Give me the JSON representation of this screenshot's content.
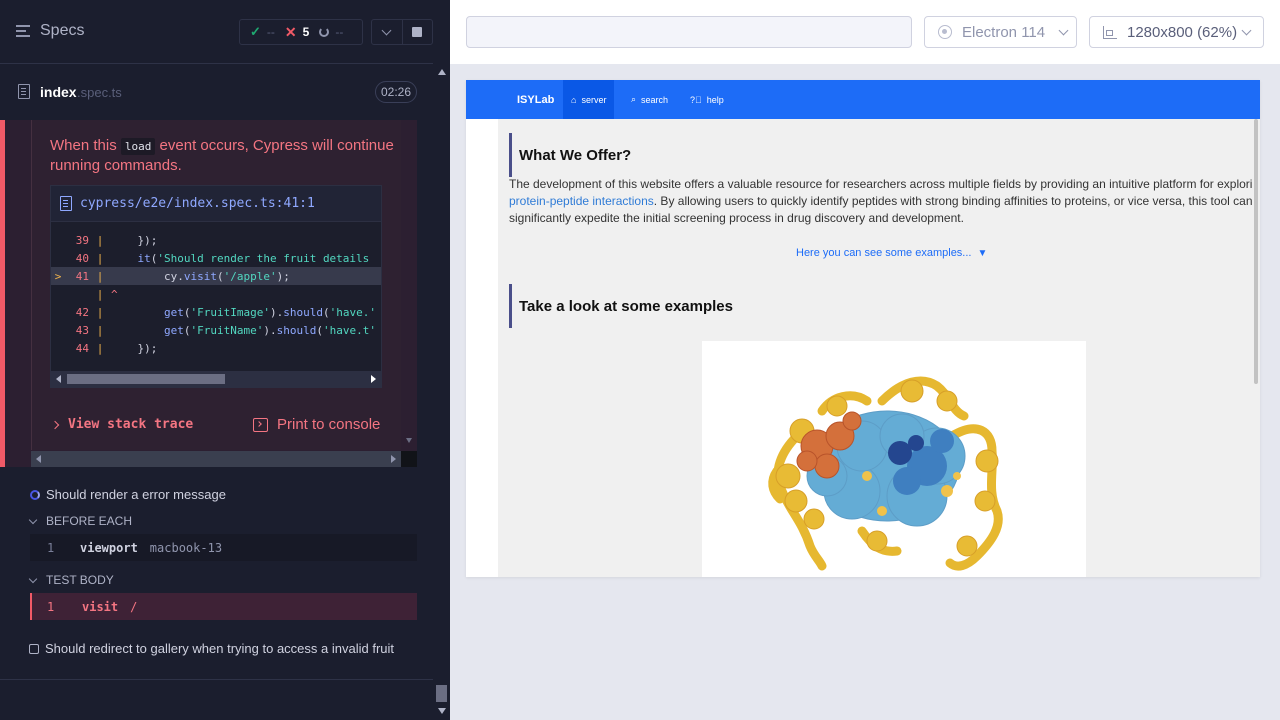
{
  "reporter": {
    "specs_label": "Specs",
    "stats": {
      "passed": "--",
      "failed": "5",
      "pending": "--"
    },
    "spec_file": {
      "name": "index",
      "ext": ".spec.ts",
      "duration": "02:26"
    },
    "error": {
      "message_before": "When this ",
      "message_code": "load",
      "message_after": " event occurs, Cypress will continue running commands.",
      "code_frame_path": "cypress/e2e/index.spec.ts:41:1",
      "code_lines": [
        {
          "num": "39",
          "text": "    });"
        },
        {
          "num": "40",
          "text": "    it('Should render the fruit details"
        },
        {
          "num": "41",
          "text": "        cy.visit('/apple');"
        },
        {
          "num": "",
          "text": "^"
        },
        {
          "num": "42",
          "text": "        get('FruitImage').should('have.'"
        },
        {
          "num": "43",
          "text": "        get('FruitName').should('have.t'"
        },
        {
          "num": "44",
          "text": "    });"
        }
      ],
      "highlight_marker": ">",
      "view_stack_trace": "View stack trace",
      "print_to_console": "Print to console"
    },
    "running_test": "Should render a error message",
    "before_each_label": "BEFORE EACH",
    "before_each_cmd": {
      "num": "1",
      "name": "viewport",
      "arg": "macbook-13"
    },
    "test_body_label": "TEST BODY",
    "test_body_cmd": {
      "num": "1",
      "name": "visit",
      "arg": "/"
    },
    "pending_test": "Should redirect to gallery when trying to access a invalid fruit"
  },
  "runner": {
    "url": "",
    "browser": "Electron 114",
    "viewport": "1280x800 (62%)"
  },
  "site": {
    "brand": "ISYLab",
    "nav": [
      {
        "icon": "home-icon",
        "label": "server"
      },
      {
        "icon": "search-icon",
        "label": "search"
      },
      {
        "icon": "help-icon",
        "label": "help"
      }
    ],
    "offer_title": "What We Offer?",
    "offer_text_before": "The development of this website offers a valuable resource for researchers across multiple fields by providing an intuitive platform for exploring ",
    "offer_link": "protein-peptide interactions",
    "offer_text_after": ". By allowing users to quickly identify peptides with strong binding affinities to proteins, or vice versa, this tool can significantly expedite the initial screening process in drug discovery and development.",
    "examples_link": "Here you can see some examples...",
    "look_title": "Take a look at some examples"
  },
  "colors": {
    "reporter_bg": "#1b1e2e",
    "failed": "#f15a67",
    "passed": "#1fa971",
    "site_nav": "#1d6cf7"
  }
}
